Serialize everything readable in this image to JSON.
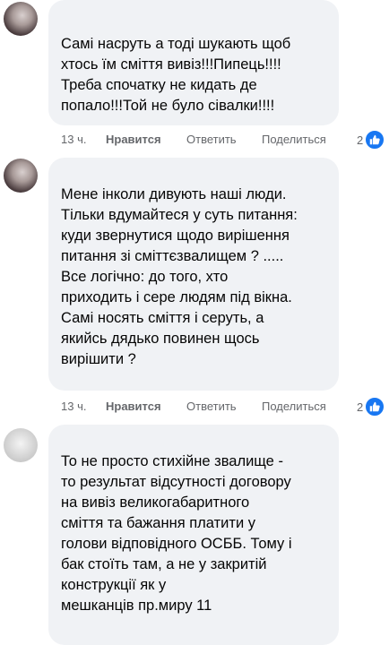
{
  "comments": [
    {
      "author": "",
      "text": "Самі насруть а тоді шукають щоб\nхтось їм сміття вивіз!!!Пипець!!!!\nТреба спочатку не кидать де\nпопало!!!Той не було сівалки!!!!",
      "time": "13 ч.",
      "like_label": "Нравится",
      "reply_label": "Ответить",
      "share_label": "Поделиться",
      "reactions": "2"
    },
    {
      "author": "",
      "text": "Мене інколи дивують наші люди.\nТільки вдумайтеся у суть питання:\nкуди звернутися щодо вирішення\nпитання зі сміттєзвалищем ? .....\nВсе логічно: до того, хто\nприходить і сере людям під вікна.\nСамі носять сміття і серуть, а\nякийсь дядько повинен щось\nвирішити ?",
      "time": "13 ч.",
      "like_label": "Нравится",
      "reply_label": "Ответить",
      "share_label": "Поделиться",
      "reactions": "2"
    },
    {
      "author": "",
      "text": "То не просто стихійне звалище -\nто результат відсутності договору\nна вивіз великогабаритного\nсміття та бажання платити у\nголови відповідного ОСББ. Тому і\nбак стоїть там, а не у закритій\nконструкції як у\nмешканців пр.миру 11",
      "time": "",
      "like_label": "",
      "reply_label": "",
      "share_label": "",
      "reactions": ""
    }
  ],
  "colors": {
    "bubble": "#f0f2f5",
    "meta": "#65676b",
    "like_blue": "#1877f2"
  },
  "icons": [
    "avatar",
    "like-reaction-icon"
  ]
}
